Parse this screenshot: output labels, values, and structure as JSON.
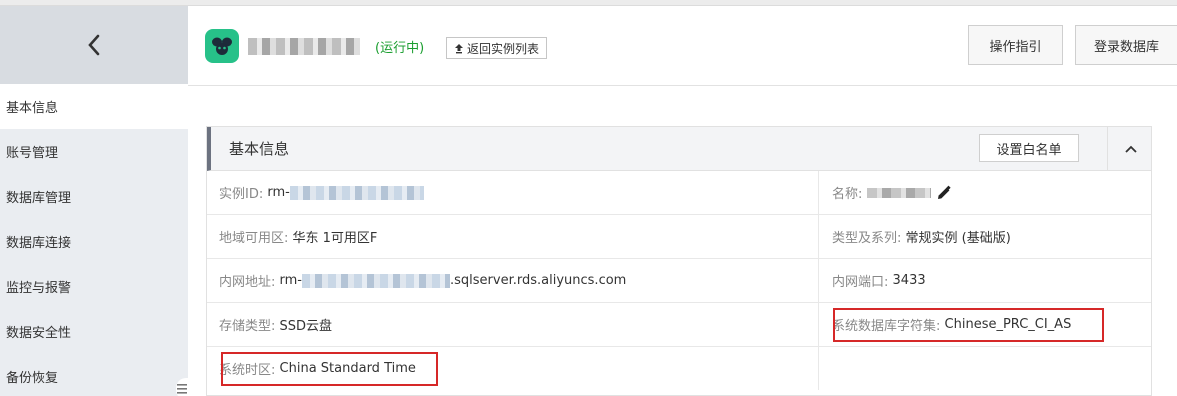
{
  "sidebar": {
    "back_icon": "chevron-left-icon",
    "items": [
      {
        "label": "基本信息",
        "active": true
      },
      {
        "label": "账号管理"
      },
      {
        "label": "数据库管理"
      },
      {
        "label": "数据库连接"
      },
      {
        "label": "监控与报警"
      },
      {
        "label": "数据安全性"
      },
      {
        "label": "备份恢复"
      }
    ]
  },
  "header": {
    "status": "(运行中)",
    "back_to_list": "返回实例列表",
    "guide_button": "操作指引",
    "login_button": "登录数据库"
  },
  "panel": {
    "title": "基本信息",
    "whitelist_button": "设置白名单",
    "rows": [
      {
        "left_label": "实例ID:",
        "left_value": "rm-",
        "right_label": "名称:",
        "right_value": ""
      },
      {
        "left_label": "地域可用区:",
        "left_value": "华东 1可用区F",
        "right_label": "类型及系列:",
        "right_value": "常规实例 (基础版)"
      },
      {
        "left_label": "内网地址:",
        "left_value_prefix": "rm-",
        "left_value_suffix": ".sqlserver.rds.aliyuncs.com",
        "right_label": "内网端口:",
        "right_value": "3433"
      },
      {
        "left_label": "存储类型:",
        "left_value": "SSD云盘",
        "right_label": "系统数据库字符集:",
        "right_value": "Chinese_PRC_CI_AS"
      },
      {
        "left_label": "系统时区:",
        "left_value": "China Standard Time"
      }
    ]
  },
  "colors": {
    "status_green": "#1a9e2f",
    "app_icon": "#27c189",
    "highlight_red": "#d62828"
  }
}
